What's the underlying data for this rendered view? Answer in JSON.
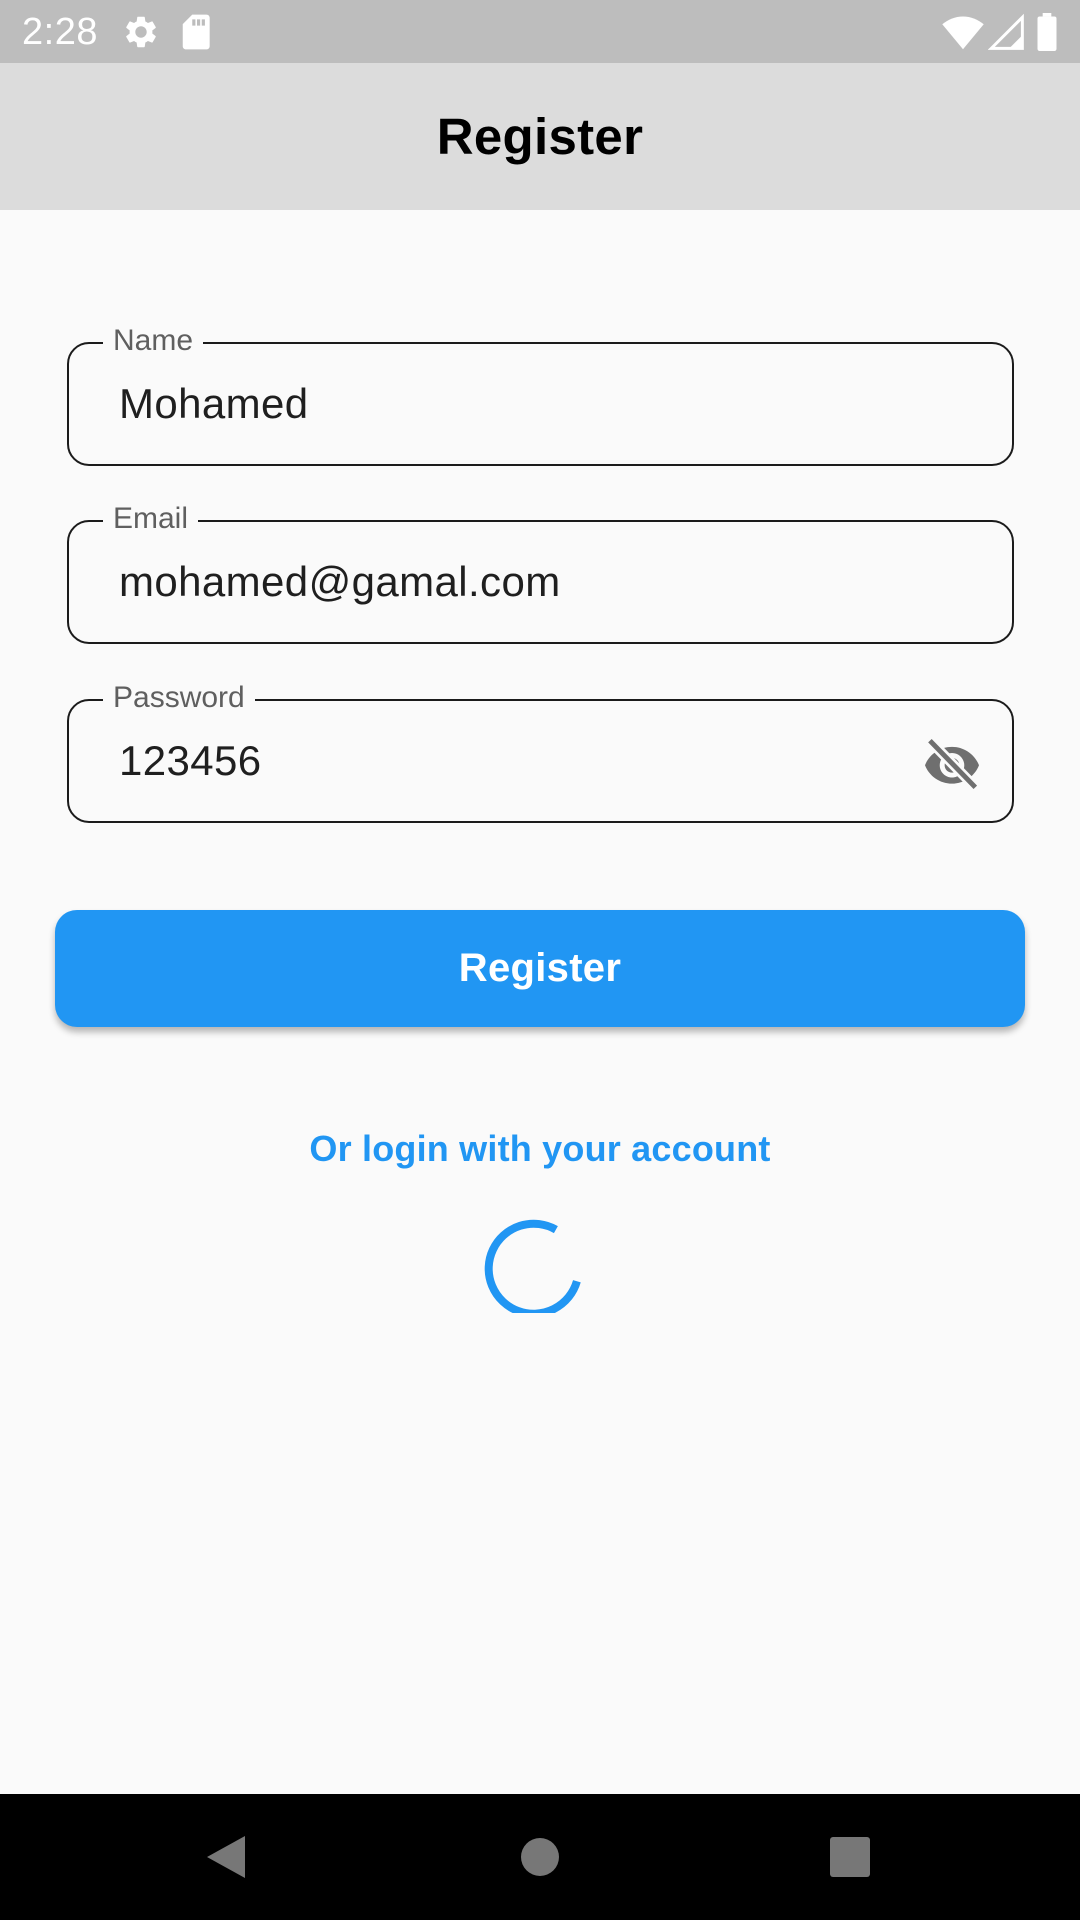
{
  "status_bar": {
    "time": "2:28",
    "icons": [
      "gear-icon",
      "sd-card-icon",
      "wifi-icon",
      "signal-icon",
      "battery-icon"
    ]
  },
  "app_bar": {
    "title": "Register"
  },
  "form": {
    "name": {
      "label": "Name",
      "value": "Mohamed"
    },
    "email": {
      "label": "Email",
      "value": "mohamed@gamal.com"
    },
    "password": {
      "label": "Password",
      "value": "123456",
      "toggle_icon": "visibility-off-icon"
    }
  },
  "register_button": {
    "label": "Register"
  },
  "login_link": {
    "text": "Or login with your account"
  },
  "loading": {
    "icon": "progress-spinner"
  },
  "nav_bar": {
    "icons": [
      "back-icon",
      "home-icon",
      "recents-icon"
    ]
  },
  "colors": {
    "accent": "#2196f3",
    "status_bar": "#bdbdbd",
    "app_bar": "#dcdcdc",
    "background": "#fafafa"
  }
}
